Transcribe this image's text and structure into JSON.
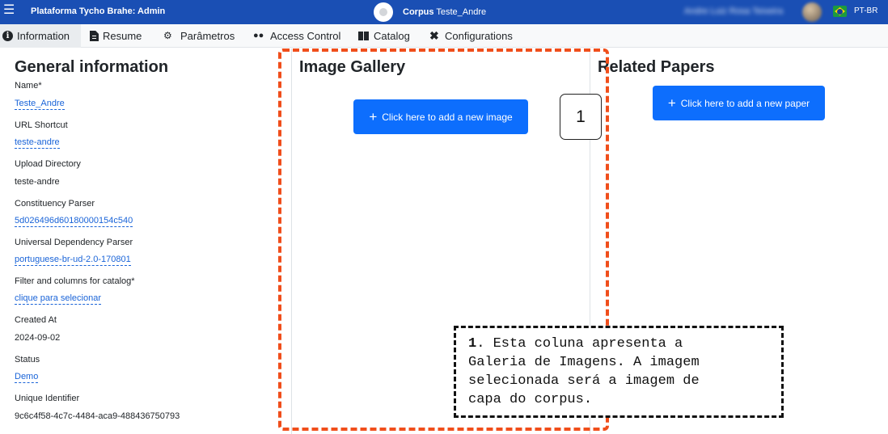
{
  "navbar": {
    "menu_icon": "hamburger-icon",
    "brand": "Plataforma Tycho Brahe: Admin",
    "corpus_prefix": "Corpus",
    "corpus_name": "Teste_Andre",
    "user_name": "Andre Luiz Rosa Teixeira",
    "language": "PT-BR",
    "color": "#1a4fb4"
  },
  "tabs": [
    {
      "label": "Information",
      "icon": "info-circle-icon",
      "active": true
    },
    {
      "label": "Resume",
      "icon": "file-icon"
    },
    {
      "label": "Parâmetros",
      "icon": "gears-icon"
    },
    {
      "label": "Access Control",
      "icon": "users-icon"
    },
    {
      "label": "Catalog",
      "icon": "book-icon"
    },
    {
      "label": "Configurations",
      "icon": "tools-icon"
    }
  ],
  "general": {
    "title": "General information",
    "fields": [
      {
        "label": "Name*",
        "value": "Teste_Andre",
        "editable": true
      },
      {
        "label": "URL Shortcut",
        "value": "teste-andre",
        "editable": true
      },
      {
        "label": "Upload Directory",
        "value": "teste-andre",
        "editable": false
      },
      {
        "label": "Constituency Parser",
        "value": "5d026496d60180000154c540",
        "editable": true
      },
      {
        "label": "Universal Dependency Parser",
        "value": "portuguese-br-ud-2.0-170801",
        "editable": true
      },
      {
        "label": "Filter and columns for catalog*",
        "value": "clique para selecionar",
        "editable": true
      },
      {
        "label": "Created At",
        "value": "2024-09-02",
        "editable": false
      },
      {
        "label": "Status",
        "value": "Demo",
        "editable": true
      },
      {
        "label": "Unique Identifier",
        "value": "9c6c4f58-4c7c-4484-aca9-488436750793",
        "editable": false
      }
    ]
  },
  "gallery": {
    "title": "Image Gallery",
    "add_button": "Click here to add a new image"
  },
  "papers": {
    "title": "Related Papers",
    "add_button": "Click here to add a new paper"
  },
  "annotation": {
    "number": "1",
    "note_number": "1",
    "note_text": ". Esta coluna apresenta a\nGaleria de Imagens. A imagem\nselecionada será a imagem de\ncapa do corpus.",
    "accent_color": "#f04e1b"
  }
}
